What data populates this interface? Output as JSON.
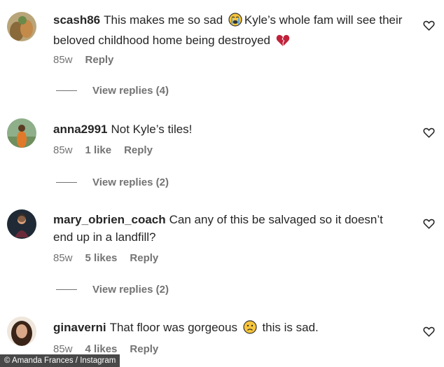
{
  "comments": [
    {
      "username": "scash86",
      "text_before": "This makes me so sad",
      "emoji1": "loudly-crying-face",
      "text_middle": "Kyle’s whole fam will see their beloved childhood home being destroyed",
      "emoji2": "broken-heart",
      "time": "85w",
      "reply": "Reply",
      "view_replies": "View replies (4)"
    },
    {
      "username": "anna2991",
      "text": "Not Kyle’s tiles!",
      "time": "85w",
      "likes": "1 like",
      "reply": "Reply",
      "view_replies": "View replies (2)"
    },
    {
      "username": "mary_obrien_coach",
      "text": "Can any of this be salvaged so it doesn’t end up in a landfill?",
      "time": "85w",
      "likes": "5 likes",
      "reply": "Reply",
      "view_replies": "View replies (2)"
    },
    {
      "username": "ginaverni",
      "text_before": "That floor was gorgeous",
      "emoji1": "frowning-face",
      "text_after": "this is sad.",
      "time": "85w",
      "likes": "4 likes",
      "reply": "Reply"
    }
  ],
  "footer": {
    "credit": "© Amanda Frances / Instagram"
  },
  "colors": {
    "text": "#262626",
    "secondary": "#737373",
    "heart_outline": "#262626"
  }
}
